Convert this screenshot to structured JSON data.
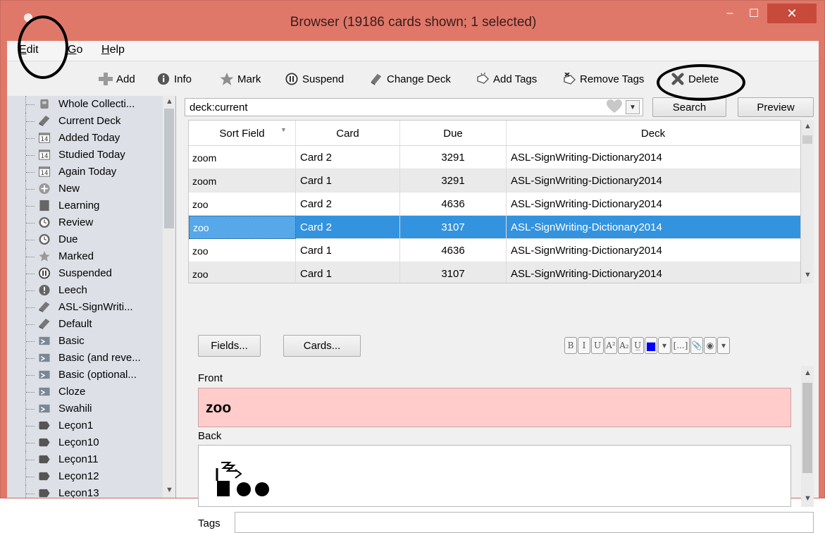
{
  "window": {
    "title": "Browser (19186 cards shown; 1 selected)",
    "minimize_glyph": "–",
    "maximize_glyph": "☐",
    "close_glyph": "✕",
    "frame_color": "#e0786a",
    "close_color": "#c74a3a"
  },
  "menubar": {
    "items": [
      {
        "accel": "E",
        "rest": "dit"
      },
      {
        "accel": "G",
        "rest": "o"
      },
      {
        "accel": "H",
        "rest": "elp"
      }
    ]
  },
  "toolbar": {
    "add": "Add",
    "info": "Info",
    "mark": "Mark",
    "suspend": "Suspend",
    "change_deck": "Change Deck",
    "add_tags": "Add Tags",
    "remove_tags": "Remove Tags",
    "delete": "Delete"
  },
  "sidebar": {
    "items": [
      {
        "label": "Whole Collecti...",
        "icon": "collection-icon"
      },
      {
        "label": "Current Deck",
        "icon": "deck-icon"
      },
      {
        "label": "Added Today",
        "icon": "calendar-icon",
        "badge": "14"
      },
      {
        "label": "Studied Today",
        "icon": "calendar-icon",
        "badge": "14"
      },
      {
        "label": "Again Today",
        "icon": "calendar-icon",
        "badge": "14"
      },
      {
        "label": "New",
        "icon": "plus-circle-icon"
      },
      {
        "label": "Learning",
        "icon": "book-icon"
      },
      {
        "label": "Review",
        "icon": "clock-icon"
      },
      {
        "label": "Due",
        "icon": "clock-icon"
      },
      {
        "label": "Marked",
        "icon": "star-icon"
      },
      {
        "label": "Suspended",
        "icon": "pause-icon"
      },
      {
        "label": "Leech",
        "icon": "leech-icon"
      },
      {
        "label": "ASL-SignWriti...",
        "icon": "deck-icon"
      },
      {
        "label": "Default",
        "icon": "deck-icon"
      },
      {
        "label": "Basic",
        "icon": "note-type-icon"
      },
      {
        "label": "Basic (and reve...",
        "icon": "note-type-icon"
      },
      {
        "label": "Basic (optional...",
        "icon": "note-type-icon"
      },
      {
        "label": "Cloze",
        "icon": "note-type-icon"
      },
      {
        "label": "Swahili",
        "icon": "note-type-icon"
      },
      {
        "label": "Leçon1",
        "icon": "tag-icon"
      },
      {
        "label": "Leçon10",
        "icon": "tag-icon"
      },
      {
        "label": "Leçon11",
        "icon": "tag-icon"
      },
      {
        "label": "Leçon12",
        "icon": "tag-icon"
      },
      {
        "label": "Leçon13",
        "icon": "tag-icon"
      }
    ]
  },
  "search": {
    "value": "deck:current",
    "search_button": "Search",
    "preview_button": "Preview"
  },
  "table": {
    "columns": [
      "Sort Field",
      "Card",
      "Due",
      "Deck"
    ],
    "rows": [
      {
        "sort_field": "zoom",
        "card": "Card 2",
        "due": "3291",
        "deck": "ASL-SignWriting-Dictionary2014"
      },
      {
        "sort_field": "zoom",
        "card": "Card 1",
        "due": "3291",
        "deck": "ASL-SignWriting-Dictionary2014"
      },
      {
        "sort_field": "zoo",
        "card": "Card 2",
        "due": "4636",
        "deck": "ASL-SignWriting-Dictionary2014"
      },
      {
        "sort_field": "zoo",
        "card": "Card 2",
        "due": "3107",
        "deck": "ASL-SignWriting-Dictionary2014"
      },
      {
        "sort_field": "zoo",
        "card": "Card 1",
        "due": "4636",
        "deck": "ASL-SignWriting-Dictionary2014"
      },
      {
        "sort_field": "zoo",
        "card": "Card 1",
        "due": "3107",
        "deck": "ASL-SignWriting-Dictionary2014"
      }
    ],
    "selected_row": 3,
    "selection_color": "#3393df"
  },
  "editor": {
    "fields_button": "Fields...",
    "cards_button": "Cards...",
    "format_buttons": [
      "B",
      "I",
      "U",
      "A²",
      "A₂",
      "U̲",
      "■",
      "▾",
      "[...]",
      "📎",
      "◉",
      "▾"
    ],
    "front_label": "Front",
    "front_value": "zoo",
    "front_color": "#ffcccb",
    "back_label": "Back",
    "tags_label": "Tags",
    "tags_value": ""
  }
}
